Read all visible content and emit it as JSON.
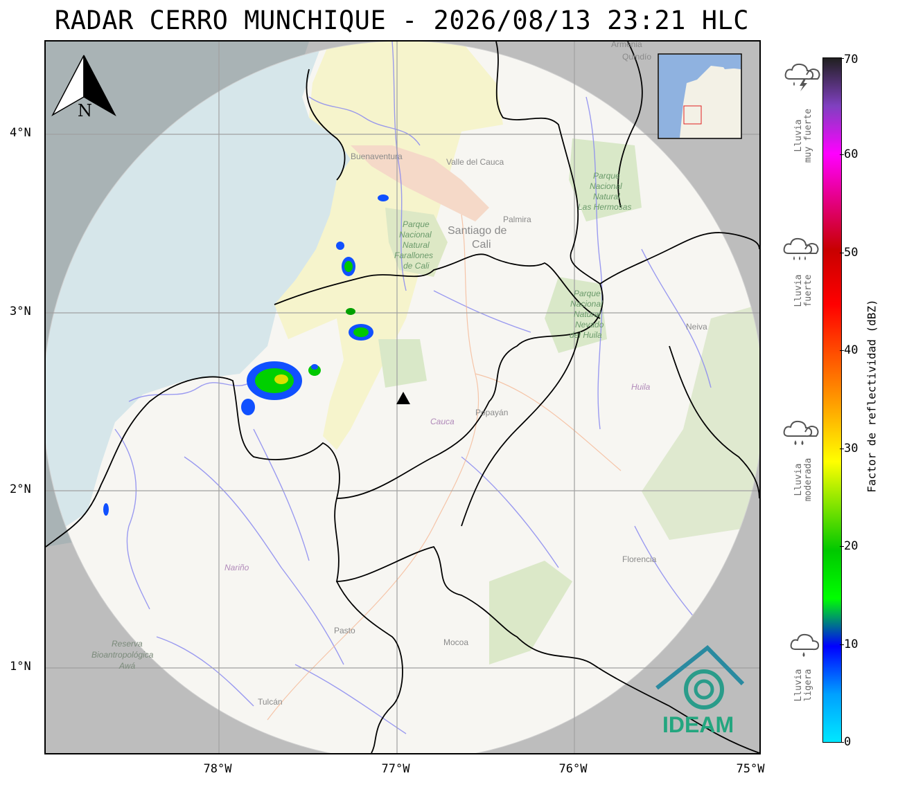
{
  "title": "RADAR CERRO MUNCHIQUE - 2026/08/13 23:21 HLC",
  "axes": {
    "latitude_labels": [
      "4°N",
      "3°N",
      "2°N",
      "1°N"
    ],
    "longitude_labels": [
      "78°W",
      "77°W",
      "76°W",
      "75°W"
    ]
  },
  "map": {
    "places": {
      "buenaventura": "Buenaventura",
      "valle": "Valle del Cauca",
      "palmira": "Palmira",
      "cali": "Santiago de\nCali",
      "farallones": "Parque\nNacional\nNatural\nFarallones\nde Cali",
      "hermosas": "Parque\nNacional\nNatural\nLas Hermosas",
      "huila_park": "Parque\nNacional\nNatural\nNevado\ndel Huila",
      "neiva": "Neiva",
      "huila": "Huila",
      "cauca": "Cauca",
      "popayan": "Popayán",
      "florencia": "Florencia",
      "narino": "Nariño",
      "pasto": "Pasto",
      "mocoa": "Mocoa",
      "tulcan": "Tulcán",
      "awa": "Reserva\nBioantropológica\nAwá",
      "armenia": "Armenia",
      "quindio": "Quindío"
    },
    "north_arrow": "N",
    "logo_text": "IDEAM",
    "radar_site_marker": "radar-site",
    "colors": {
      "water": "#d6e6ea",
      "land": "#f7f6f2",
      "outside_range": "#bdbdbd",
      "valle_fill": "#f6f4cc",
      "river": "#8a8af0",
      "logo": "#2a9c8a"
    }
  },
  "colorbar": {
    "label": "Factor de reflectividad (dBZ)",
    "ticks": [
      "0",
      "10",
      "20",
      "30",
      "40",
      "50",
      "60",
      "70"
    ],
    "min": 0,
    "max": 70
  },
  "rain_categories": [
    {
      "label1": "Lluvia",
      "label2": "ligera",
      "icon": "light-rain-icon"
    },
    {
      "label1": "Lluvia",
      "label2": "moderada",
      "icon": "moderate-rain-icon"
    },
    {
      "label1": "Lluvia",
      "label2": "fuerte",
      "icon": "heavy-rain-icon"
    },
    {
      "label1": "Lluvia",
      "label2": "muy fuerte",
      "icon": "storm-icon"
    }
  ]
}
